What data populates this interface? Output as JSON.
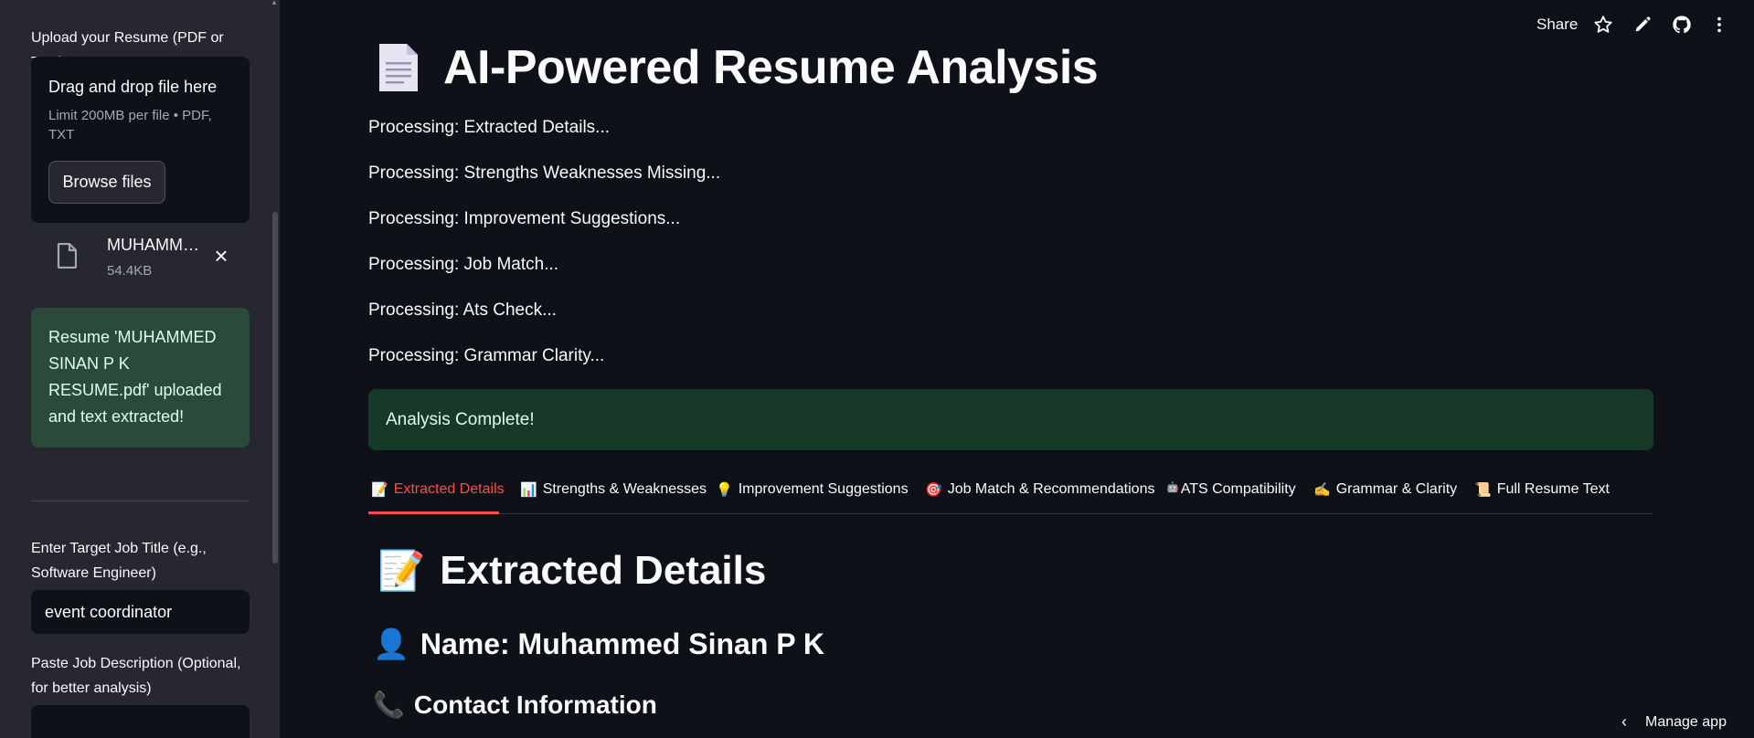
{
  "sidebar": {
    "upload_label": "Upload your Resume (PDF or TXT)",
    "dropzone_title": "Drag and drop file here",
    "dropzone_limit": "Limit 200MB per file • PDF, TXT",
    "browse_button": "Browse files",
    "file_name": "MUHAMMED SINAN P K RESUME.pdf",
    "file_size": "54.4KB",
    "success_message": "Resume 'MUHAMMED SINAN P K RESUME.pdf' uploaded and text extracted!",
    "job_title_label": "Enter Target Job Title (e.g., Software Engineer)",
    "job_title_value": "event coordinator",
    "job_desc_label": "Paste Job Description (Optional, for better analysis)"
  },
  "toolbar": {
    "share_label": "Share",
    "icons": [
      "star-icon",
      "edit-icon",
      "github-icon",
      "more-icon"
    ]
  },
  "main": {
    "title": "AI-Powered Resume Analysis",
    "processing": [
      "Processing: Extracted Details...",
      "Processing: Strengths Weaknesses Missing...",
      "Processing: Improvement Suggestions...",
      "Processing: Job Match...",
      "Processing: Ats Check...",
      "Processing: Grammar Clarity..."
    ],
    "complete_message": "Analysis Complete!",
    "tabs": [
      {
        "icon": "📝",
        "label": "Extracted Details",
        "active": true
      },
      {
        "icon": "📊",
        "label": "Strengths & Weaknesses"
      },
      {
        "icon": "💡",
        "label": "Improvement Suggestions"
      },
      {
        "icon": "🎯",
        "label": "Job Match & Recommendations"
      },
      {
        "icon": "🤖",
        "label": "ATS Compatibility"
      },
      {
        "icon": "✍️",
        "label": "Grammar & Clarity"
      },
      {
        "icon": "📜",
        "label": "Full Resume Text"
      }
    ],
    "section_title": "Extracted Details",
    "section_icon": "📝",
    "name_icon": "👤",
    "name_heading": "Name: Muhammed Sinan P K",
    "contact_icon": "📞",
    "contact_heading": "Contact Information"
  },
  "footer": {
    "manage_app": "Manage app"
  },
  "colors": {
    "background": "#0e1117",
    "sidebar": "#262730",
    "accent": "#ff4b4b",
    "success_bg": "#173928"
  }
}
